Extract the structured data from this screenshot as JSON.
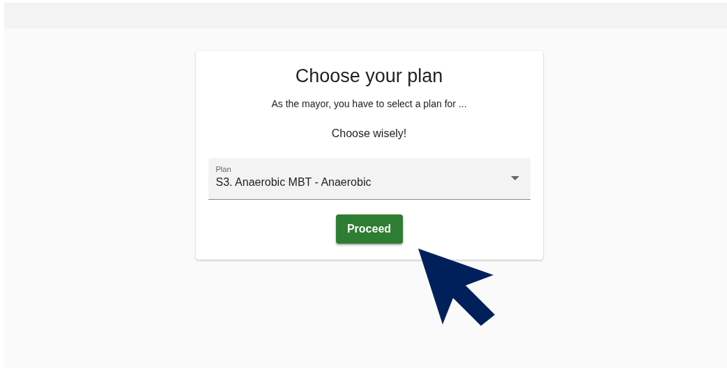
{
  "card": {
    "title": "Choose your plan",
    "description": "As the mayor, you have to select a plan for ...",
    "hint": "Choose wisely!"
  },
  "plan_select": {
    "label": "Plan",
    "value": "S3. Anaerobic MBT - Anaerobic"
  },
  "buttons": [
    {
      "label": "Proceed"
    }
  ]
}
